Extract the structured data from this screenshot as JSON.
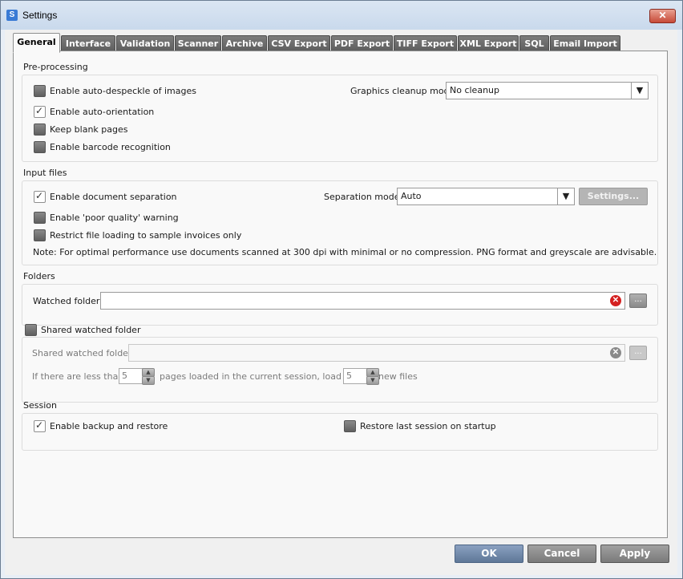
{
  "window": {
    "title": "Settings",
    "app_icon": "S",
    "close_label": "✕"
  },
  "tabs": [
    {
      "label": "General"
    },
    {
      "label": "Interface"
    },
    {
      "label": "Validation"
    },
    {
      "label": "Scanner"
    },
    {
      "label": "Archive"
    },
    {
      "label": "CSV Export"
    },
    {
      "label": "PDF Export"
    },
    {
      "label": "TIFF Export"
    },
    {
      "label": "XML Export"
    },
    {
      "label": "SQL"
    },
    {
      "label": "Email Import"
    }
  ],
  "preprocessing": {
    "title": "Pre-processing",
    "auto_despeckle": {
      "label": "Enable auto-despeckle of images",
      "checked": false
    },
    "auto_orientation": {
      "label": "Enable auto-orientation",
      "checked": true
    },
    "keep_blank": {
      "label": "Keep blank pages",
      "checked": false
    },
    "barcode": {
      "label": "Enable barcode recognition",
      "checked": false
    },
    "cleanup_label": "Graphics cleanup mode:",
    "cleanup_value": "No cleanup"
  },
  "input_files": {
    "title": "Input files",
    "doc_separation": {
      "label": "Enable document separation",
      "checked": true
    },
    "poor_quality": {
      "label": "Enable 'poor quality' warning",
      "checked": false
    },
    "restrict_loading": {
      "label": "Restrict file loading to sample invoices only",
      "checked": false
    },
    "separation_label": "Separation mode:",
    "separation_value": "Auto",
    "settings_button": "Settings...",
    "note": "Note: For optimal performance use documents scanned at 300 dpi with minimal or no compression. PNG format and greyscale are advisable."
  },
  "folders": {
    "title": "Folders",
    "watched_label": "Watched folder:",
    "watched_value": "",
    "browse": "..."
  },
  "shared": {
    "title": "Shared watched folder",
    "checked": false,
    "folder_label": "Shared watched folder:",
    "folder_value": "",
    "browse": "...",
    "less_than_text": "If there are less than",
    "less_than_value": "5",
    "pages_loaded_text": "pages loaded in the current session, load up to",
    "load_up_value": "5",
    "new_files_text": "new files"
  },
  "session": {
    "title": "Session",
    "backup_restore": {
      "label": "Enable backup and restore",
      "checked": true
    },
    "restore_last": {
      "label": "Restore last session on startup",
      "checked": false
    }
  },
  "footer": {
    "ok": "OK",
    "cancel": "Cancel",
    "apply": "Apply"
  },
  "colors": {
    "ok_button": "#6d85a8",
    "tab_bg": "#6b6b6b",
    "error_icon": "#d42020"
  }
}
